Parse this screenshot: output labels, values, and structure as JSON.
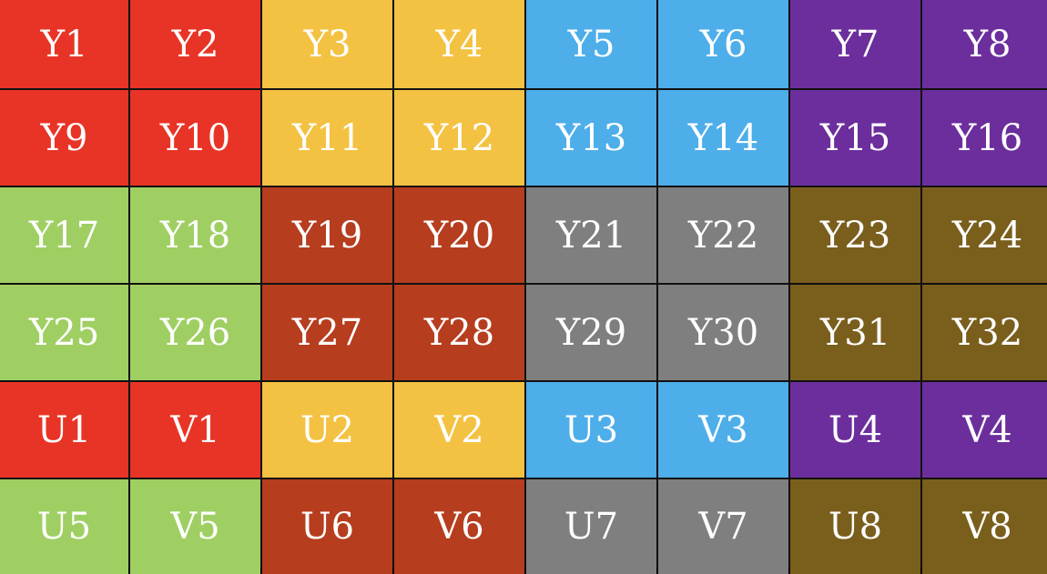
{
  "colors": {
    "red": "#E83426",
    "yellow": "#F4C242",
    "blue": "#4DAEE9",
    "purple": "#6C2E9C",
    "green": "#9FCF63",
    "rust": "#B63D1E",
    "gray": "#7F7F7F",
    "olive": "#7A5E1C"
  },
  "grid": {
    "rows": [
      [
        {
          "label": "Y1",
          "color": "red"
        },
        {
          "label": "Y2",
          "color": "red"
        },
        {
          "label": "Y3",
          "color": "yellow"
        },
        {
          "label": "Y4",
          "color": "yellow"
        },
        {
          "label": "Y5",
          "color": "blue"
        },
        {
          "label": "Y6",
          "color": "blue"
        },
        {
          "label": "Y7",
          "color": "purple"
        },
        {
          "label": "Y8",
          "color": "purple"
        }
      ],
      [
        {
          "label": "Y9",
          "color": "red"
        },
        {
          "label": "Y10",
          "color": "red"
        },
        {
          "label": "Y11",
          "color": "yellow"
        },
        {
          "label": "Y12",
          "color": "yellow"
        },
        {
          "label": "Y13",
          "color": "blue"
        },
        {
          "label": "Y14",
          "color": "blue"
        },
        {
          "label": "Y15",
          "color": "purple"
        },
        {
          "label": "Y16",
          "color": "purple"
        }
      ],
      [
        {
          "label": "Y17",
          "color": "green"
        },
        {
          "label": "Y18",
          "color": "green"
        },
        {
          "label": "Y19",
          "color": "rust"
        },
        {
          "label": "Y20",
          "color": "rust"
        },
        {
          "label": "Y21",
          "color": "gray"
        },
        {
          "label": "Y22",
          "color": "gray"
        },
        {
          "label": "Y23",
          "color": "olive"
        },
        {
          "label": "Y24",
          "color": "olive"
        }
      ],
      [
        {
          "label": "Y25",
          "color": "green"
        },
        {
          "label": "Y26",
          "color": "green"
        },
        {
          "label": "Y27",
          "color": "rust"
        },
        {
          "label": "Y28",
          "color": "rust"
        },
        {
          "label": "Y29",
          "color": "gray"
        },
        {
          "label": "Y30",
          "color": "gray"
        },
        {
          "label": "Y31",
          "color": "olive"
        },
        {
          "label": "Y32",
          "color": "olive"
        }
      ],
      [
        {
          "label": "U1",
          "color": "red"
        },
        {
          "label": "V1",
          "color": "red"
        },
        {
          "label": "U2",
          "color": "yellow"
        },
        {
          "label": "V2",
          "color": "yellow"
        },
        {
          "label": "U3",
          "color": "blue"
        },
        {
          "label": "V3",
          "color": "blue"
        },
        {
          "label": "U4",
          "color": "purple"
        },
        {
          "label": "V4",
          "color": "purple"
        }
      ],
      [
        {
          "label": "U5",
          "color": "green"
        },
        {
          "label": "V5",
          "color": "green"
        },
        {
          "label": "U6",
          "color": "rust"
        },
        {
          "label": "V6",
          "color": "rust"
        },
        {
          "label": "U7",
          "color": "gray"
        },
        {
          "label": "V7",
          "color": "gray"
        },
        {
          "label": "U8",
          "color": "olive"
        },
        {
          "label": "V8",
          "color": "olive"
        }
      ]
    ]
  }
}
